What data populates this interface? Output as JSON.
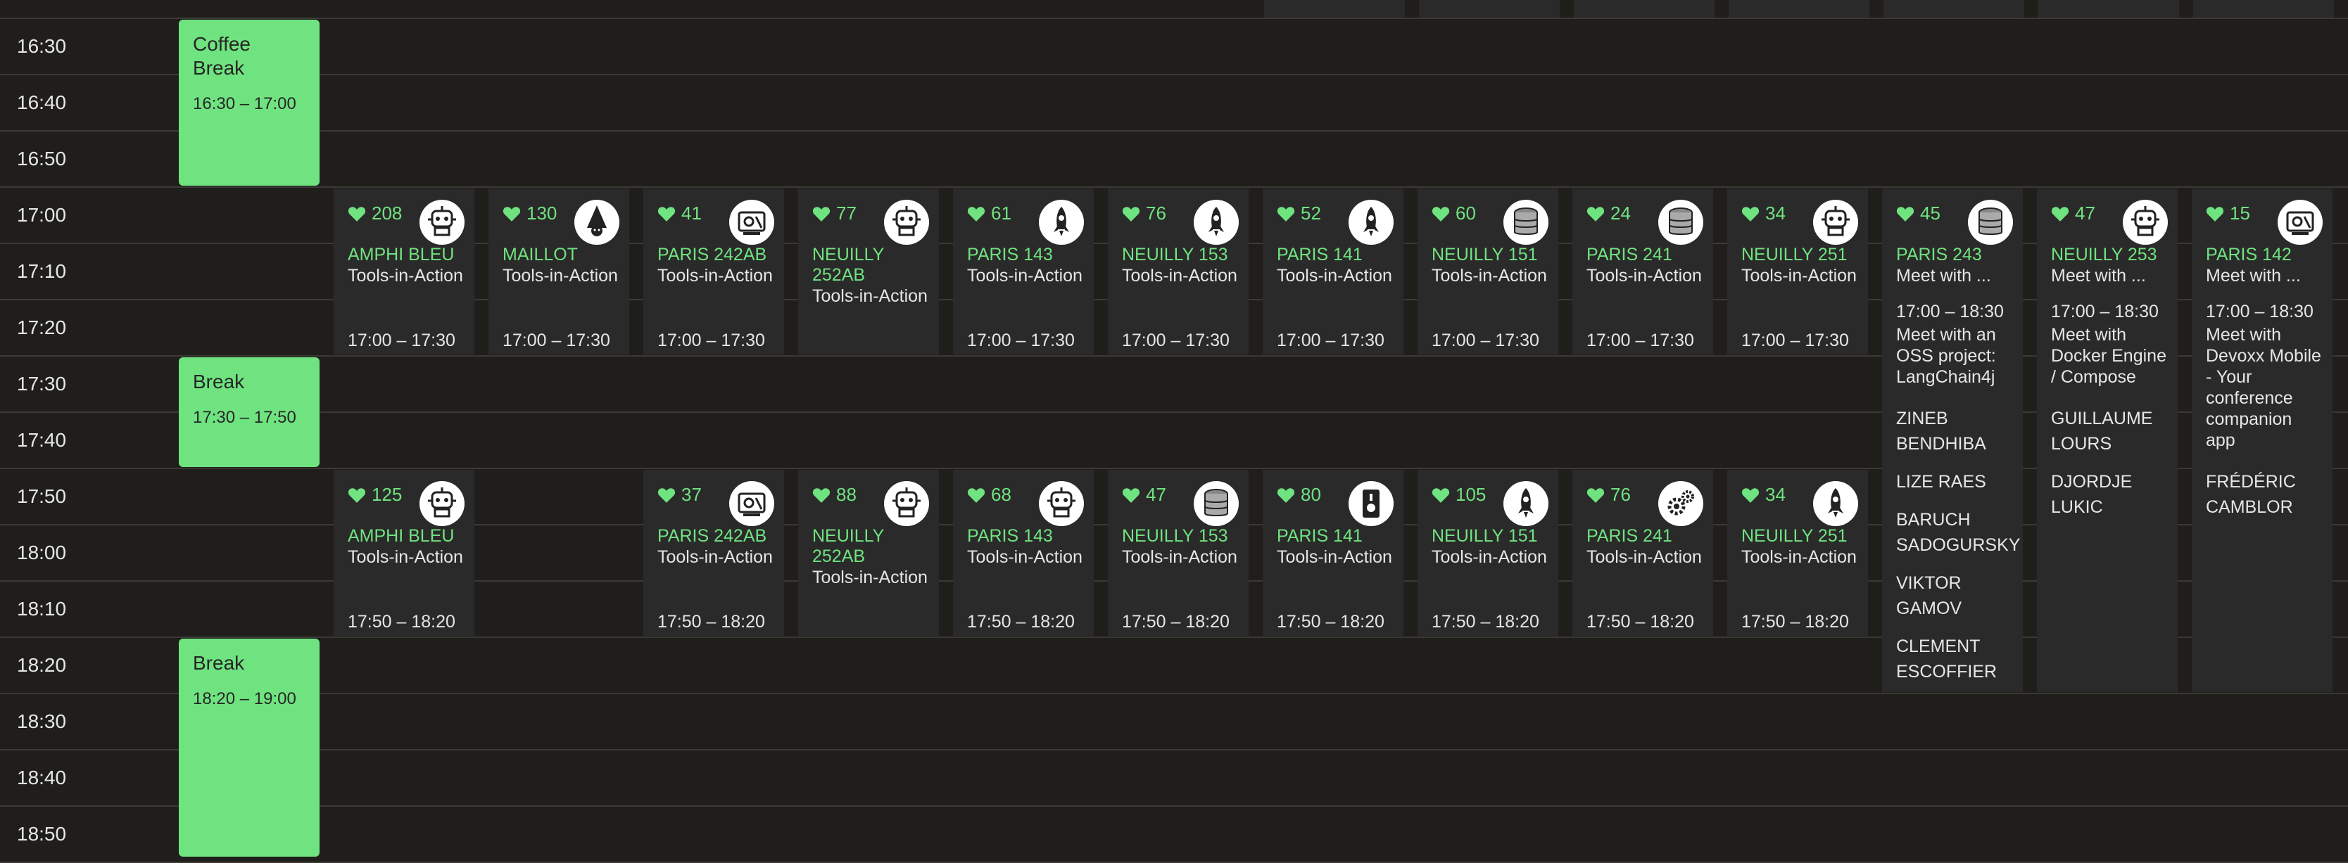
{
  "time_labels": [
    "16:30",
    "16:40",
    "16:50",
    "17:00",
    "17:10",
    "17:20",
    "17:30",
    "17:40",
    "17:50",
    "18:00",
    "18:10",
    "18:20",
    "18:30",
    "18:40",
    "18:50"
  ],
  "breaks": [
    {
      "title": "Coffee Break",
      "time": "16:30 – 17:00"
    },
    {
      "title": "Break",
      "time": "17:30 – 17:50"
    },
    {
      "title": "Break",
      "time": "18:20 – 19:00"
    }
  ],
  "row1": [
    {
      "count": "208",
      "room": "AMPHI BLEU",
      "track": "Tools-in-Action",
      "time": "17:00 – 17:30",
      "icon": "robot-icon"
    },
    {
      "count": "130",
      "room": "MAILLOT",
      "track": "Tools-in-Action",
      "time": "17:00 – 17:30",
      "icon": "wizard-icon"
    },
    {
      "count": "41",
      "room": "PARIS 242AB",
      "track": "Tools-in-Action",
      "time": "17:00 – 17:30",
      "icon": "tools-icon"
    },
    {
      "count": "77",
      "room": "NEUILLY 252AB",
      "track": "Tools-in-Action",
      "time": "",
      "icon": "robot-icon"
    },
    {
      "count": "61",
      "room": "PARIS 143",
      "track": "Tools-in-Action",
      "time": "17:00 – 17:30",
      "icon": "rocket-icon"
    },
    {
      "count": "76",
      "room": "NEUILLY 153",
      "track": "Tools-in-Action",
      "time": "17:00 – 17:30",
      "icon": "rocket-icon"
    },
    {
      "count": "52",
      "room": "PARIS 141",
      "track": "Tools-in-Action",
      "time": "17:00 – 17:30",
      "icon": "rocket-icon"
    },
    {
      "count": "60",
      "room": "NEUILLY 151",
      "track": "Tools-in-Action",
      "time": "17:00 – 17:30",
      "icon": "database-icon"
    },
    {
      "count": "24",
      "room": "PARIS 241",
      "track": "Tools-in-Action",
      "time": "17:00 – 17:30",
      "icon": "database-icon"
    },
    {
      "count": "34",
      "room": "NEUILLY 251",
      "track": "Tools-in-Action",
      "time": "17:00 – 17:30",
      "icon": "robot-icon"
    }
  ],
  "row2": [
    {
      "count": "125",
      "room": "AMPHI BLEU",
      "track": "Tools-in-Action",
      "time": "17:50 – 18:20",
      "icon": "robot-icon"
    },
    {
      "count": "37",
      "room": "PARIS 242AB",
      "track": "Tools-in-Action",
      "time": "17:50 – 18:20",
      "icon": "tools-icon"
    },
    {
      "count": "88",
      "room": "NEUILLY 252AB",
      "track": "Tools-in-Action",
      "time": "",
      "icon": "robot-icon"
    },
    {
      "count": "68",
      "room": "PARIS 143",
      "track": "Tools-in-Action",
      "time": "17:50 – 18:20",
      "icon": "robot-icon"
    },
    {
      "count": "47",
      "room": "NEUILLY 153",
      "track": "Tools-in-Action",
      "time": "17:50 – 18:20",
      "icon": "database-icon"
    },
    {
      "count": "80",
      "room": "PARIS 141",
      "track": "Tools-in-Action",
      "time": "17:50 – 18:20",
      "icon": "security-icon"
    },
    {
      "count": "105",
      "room": "NEUILLY 151",
      "track": "Tools-in-Action",
      "time": "17:50 – 18:20",
      "icon": "rocket-icon"
    },
    {
      "count": "76",
      "room": "PARIS 241",
      "track": "Tools-in-Action",
      "time": "17:50 – 18:20",
      "icon": "gears-icon"
    },
    {
      "count": "34",
      "room": "NEUILLY 251",
      "track": "Tools-in-Action",
      "time": "17:50 – 18:20",
      "icon": "rocket-icon"
    }
  ],
  "meets": [
    {
      "count": "45",
      "room": "PARIS 243",
      "track": "Meet with ...",
      "time": "17:00 – 18:30",
      "desc": "Meet with an OSS project: LangChain4j",
      "speakers": [
        "ZINEB BENDHIBA",
        "LIZE RAES",
        "BARUCH SADOGURSKY",
        "VIKTOR GAMOV",
        "CLEMENT ESCOFFIER"
      ],
      "icon": "database-icon"
    },
    {
      "count": "47",
      "room": "NEUILLY 253",
      "track": "Meet with ...",
      "time": "17:00 – 18:30",
      "desc": "Meet with Docker Engine / Compose",
      "speakers": [
        "GUILLAUME LOURS",
        "DJORDJE LUKIC"
      ],
      "icon": "robot-icon"
    },
    {
      "count": "15",
      "room": "PARIS 142",
      "track": "Meet with ...",
      "time": "17:00 – 18:30",
      "desc": "Meet with Devoxx Mobile - Your conference companion app",
      "speakers": [
        "FRéDéRIC CAMBLOR"
      ],
      "icon": "tools-icon"
    }
  ],
  "colors": {
    "accent": "#6fe380",
    "card": "#2b2a2a",
    "background": "#1f1e1b"
  }
}
